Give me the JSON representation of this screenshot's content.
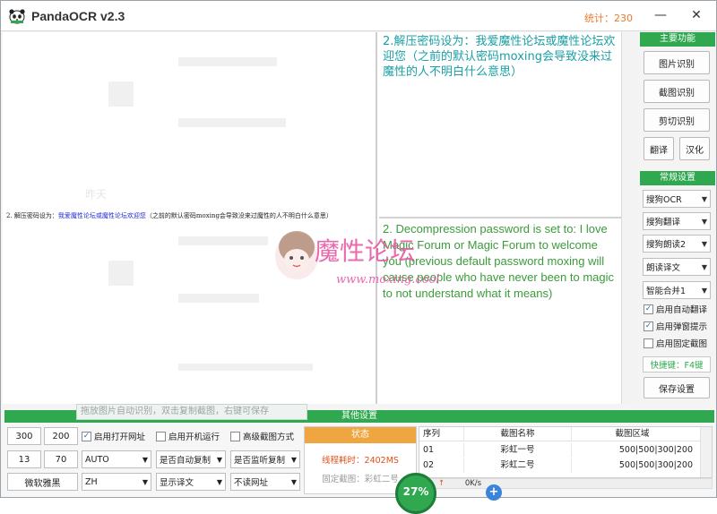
{
  "app": {
    "title": "PandaOCR v2.3",
    "stats_label": "统计：230"
  },
  "window_controls": {
    "minimize": "—",
    "maximize": "☐",
    "close": "✕"
  },
  "left_pane": {
    "doc_prefix": "2. 解压密码设为：",
    "doc_link": "我爱魔性论坛或魔性论坛欢迎您",
    "doc_suffix": "（之前的默认密码moxing会导致没来过魔性的人不明白什么意思）"
  },
  "translation_top": {
    "text": "2.解压密码设为：我爱魔性论坛或魔性论坛欢迎您（之前的默认密码moxing会导致没来过魔性的人不明白什么意思）"
  },
  "translation_bottom": {
    "text": "2. Decompression password is set to: I love Magic Forum or Magic Forum to welcome you (previous default password moxing will cause people who have never been to magic to not understand what it means)"
  },
  "watermark": {
    "text": "魔性论坛",
    "url": "www.moxing.cool"
  },
  "main_functions": {
    "header": "主要功能",
    "image_ocr": "图片识别",
    "screenshot_ocr": "截图识别",
    "clipboard_ocr": "剪切识别",
    "translate": "翻译",
    "localize": "汉化"
  },
  "common_settings": {
    "header": "常规设置",
    "ocr_engine": "搜狗OCR",
    "translate_engine": "搜狗翻译",
    "voice": "搜狗朗读2",
    "read_mode": "朗读译文",
    "merge_mode": "智能合并1",
    "checks": [
      {
        "label": "启用自动翻译",
        "checked": true
      },
      {
        "label": "启用弹窗提示",
        "checked": true
      },
      {
        "label": "启用固定截图",
        "checked": false
      }
    ],
    "hotkey": "快捷键：F4键",
    "save": "保存设置"
  },
  "hint": "拖放图片自动识别，双击复制截图，右键可保存",
  "other_settings": {
    "header": "其他设置",
    "fields": [
      "300",
      "200",
      "13",
      "70"
    ],
    "font": "微软雅黑",
    "checks": [
      {
        "label": "启用打开网址",
        "checked": true
      },
      {
        "label": "启用开机运行",
        "checked": false
      },
      {
        "label": "高级截图方式",
        "checked": false
      }
    ],
    "dropdowns": {
      "mode": "AUTO",
      "lang": "ZH",
      "auto_copy": "是否自动复制",
      "show_translation": "显示译文",
      "monitor_copy": "是否监听复制",
      "no_url": "不读网址"
    }
  },
  "status": {
    "header": "状态",
    "elapsed": "线程耗时：2402MS",
    "fixed": "固定截图：彩虹二号"
  },
  "table": {
    "columns": [
      "序列",
      "截图名称",
      "截图区域"
    ],
    "rows": [
      [
        "01",
        "彩虹一号",
        "500|500|300|200"
      ],
      [
        "02",
        "彩虹二号",
        "500|500|300|200"
      ]
    ]
  },
  "gauge": {
    "percent": "27%",
    "speed": "0K/s"
  },
  "colors": {
    "accent": "#2fa84f",
    "stats": "#e87a2a",
    "status": "#f0a640",
    "top_text": "#1aa0a4",
    "bottom_text": "#3b9b3b"
  }
}
